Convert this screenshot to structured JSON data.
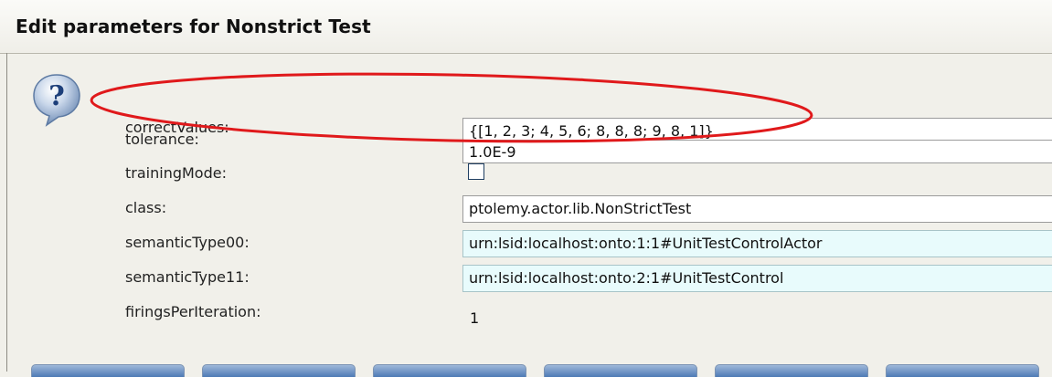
{
  "dialog": {
    "title": "Edit parameters for Nonstrict Test"
  },
  "params": {
    "correctValues": {
      "label": "correctValues:",
      "value": "{[1, 2, 3; 4, 5, 6; 8, 8, 8; 9, 8, 1]}"
    },
    "tolerance": {
      "label": "tolerance:",
      "value": "1.0E-9"
    },
    "trainingMode": {
      "label": "trainingMode:",
      "checked": false
    },
    "class": {
      "label": "class:",
      "value": "ptolemy.actor.lib.NonStrictTest"
    },
    "semanticType00": {
      "label": "semanticType00:",
      "value": "urn:lsid:localhost:onto:1:1#UnitTestControlActor"
    },
    "semanticType11": {
      "label": "semanticType11:",
      "value": "urn:lsid:localhost:onto:2:1#UnitTestControl"
    },
    "firingsPerIteration": {
      "label": "firingsPerIteration:",
      "value": "1"
    }
  },
  "icons": {
    "help": "question-mark-bubble-icon"
  },
  "colors": {
    "highlight_ellipse": "#e0191b",
    "readonly_field_bg": "#e8fbfc",
    "button_blue": "#4d7ab5"
  }
}
